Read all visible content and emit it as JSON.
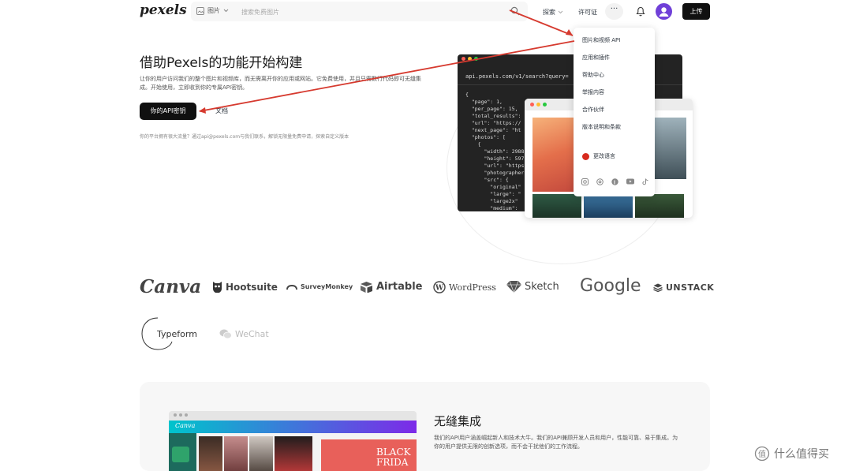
{
  "nav": {
    "logo": "pexels",
    "search_type": "图片",
    "search_placeholder": "搜索免费图片",
    "explore": "探索",
    "license": "许可证",
    "more": "···",
    "upload": "上传"
  },
  "menu": {
    "items": [
      "图片和视频 API",
      "应用和插件",
      "帮助中心",
      "举报内容",
      "合作伙伴",
      "版本说明和条款"
    ],
    "language": "更改语言"
  },
  "hero": {
    "title": "借助Pexels的功能开始构建",
    "desc": "让你的用户访问我们的整个图片和视频库，而无需离开你的应用或网站。它免费使用，并且只需数行代码即可无缝集成。开始使用，立即收到你的专属API密钥。",
    "api_key_button": "你的API密钥",
    "docs_button": "文档",
    "note": "你的平台拥有很大流量？通过api@pexels.com与我们联系，解锁无限量免费申请，探索自定义版本"
  },
  "code": {
    "url": "api.pexels.com/v1/search?query=",
    "lines": [
      "{",
      "  \"page\": 1,",
      "  \"per_page\": 15,",
      "  \"total_results\":",
      "  \"url\": \"https://",
      "  \"next_page\": \"ht",
      "  \"photos\": [",
      "    {",
      "      \"width\": 2988",
      "      \"height\": 597",
      "      \"url\": \"https",
      "      \"photographer",
      "      \"src\": {",
      "        \"original\"",
      "        \"large\": \"",
      "        \"large2x\"",
      "        \"medium\": ",
      "        \"small\": \"",
      "        \"portrait\"",
      "        \"landscape"
    ]
  },
  "logos": [
    "Canva",
    "Hootsuite",
    "SurveyMonkey",
    "Airtable",
    "WordPress",
    "Sketch",
    "Google",
    "UNSTACK",
    "Typeform",
    "WeChat"
  ],
  "feature": {
    "title": "无缝集成",
    "desc": "我们的API用户涵盖崛起新人和技术大牛。我们的API兼顾开发人员和用户，性能可靠、易于集成。为你的用户提供无限的创新选项，而不会干扰他们的工作流程。",
    "mock_brand": "Canva",
    "black_friday": "BLACK FRIDA"
  },
  "watermark": "值 什么值得买",
  "colors": {
    "accent": "#05a081",
    "dark": "#101010",
    "arrow": "#d63a2f"
  }
}
